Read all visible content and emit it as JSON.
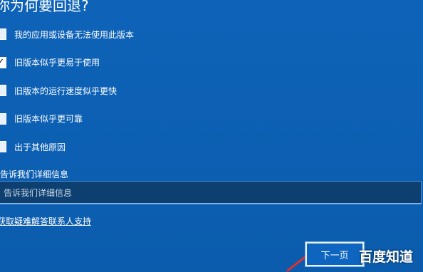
{
  "page": {
    "title": "你为何要回退?"
  },
  "options": [
    {
      "label": "我的应用或设备无法使用此版本",
      "checked": false
    },
    {
      "label": "旧版本似乎更易于使用",
      "checked": true
    },
    {
      "label": "旧版本的运行速度似乎更快",
      "checked": false
    },
    {
      "label": "旧版本似乎更可靠",
      "checked": false
    },
    {
      "label": "出于其他原因",
      "checked": false
    }
  ],
  "details": {
    "label": "告诉我们详细信息",
    "placeholder": "告诉我们详细信息"
  },
  "help_link": "获取疑难解答联系人支持",
  "next_button": "下一页",
  "watermark": "百度知道",
  "colors": {
    "background": "#0b5fb3",
    "input_background": "#0d3f70",
    "pointer": "#e0312b"
  },
  "checkmark_glyph": "✓"
}
